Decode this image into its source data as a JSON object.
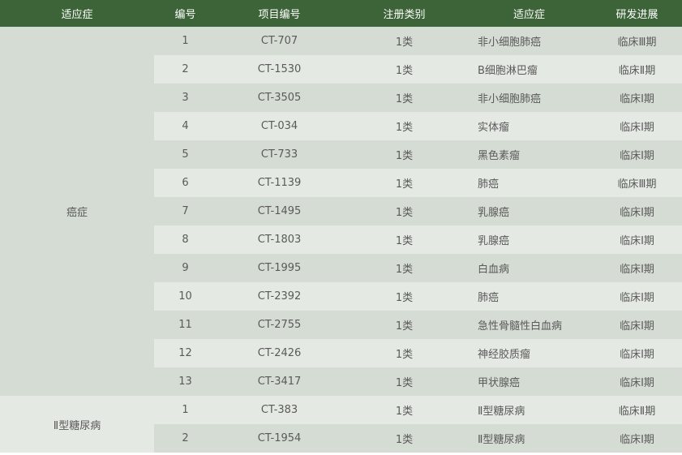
{
  "header": {
    "group": "适应症",
    "num": "编号",
    "code": "项目编号",
    "reg": "注册类别",
    "ind": "适应症",
    "stage": "研发进展"
  },
  "groups": [
    {
      "name": "癌症",
      "rows": [
        {
          "num": "1",
          "code": "CT-707",
          "reg": "1类",
          "ind": "非小细胞肺癌",
          "stage": "临床Ⅲ期"
        },
        {
          "num": "2",
          "code": "CT-1530",
          "reg": "1类",
          "ind": "B细胞淋巴瘤",
          "stage": "临床Ⅱ期"
        },
        {
          "num": "3",
          "code": "CT-3505",
          "reg": "1类",
          "ind": "非小细胞肺癌",
          "stage": "临床Ⅰ期"
        },
        {
          "num": "4",
          "code": "CT-034",
          "reg": "1类",
          "ind": "实体瘤",
          "stage": "临床Ⅰ期"
        },
        {
          "num": "5",
          "code": "CT-733",
          "reg": "1类",
          "ind": "黑色素瘤",
          "stage": "临床Ⅰ期"
        },
        {
          "num": "6",
          "code": "CT-1139",
          "reg": "1类",
          "ind": "肺癌",
          "stage": "临床Ⅲ期"
        },
        {
          "num": "7",
          "code": "CT-1495",
          "reg": "1类",
          "ind": "乳腺癌",
          "stage": "临床Ⅰ期"
        },
        {
          "num": "8",
          "code": "CT-1803",
          "reg": "1类",
          "ind": "乳腺癌",
          "stage": "临床Ⅰ期"
        },
        {
          "num": "9",
          "code": "CT-1995",
          "reg": "1类",
          "ind": "白血病",
          "stage": "临床Ⅰ期"
        },
        {
          "num": "10",
          "code": "CT-2392",
          "reg": "1类",
          "ind": "肺癌",
          "stage": "临床Ⅰ期"
        },
        {
          "num": "11",
          "code": "CT-2755",
          "reg": "1类",
          "ind": "急性骨髓性白血病",
          "stage": "临床Ⅰ期"
        },
        {
          "num": "12",
          "code": "CT-2426",
          "reg": "1类",
          "ind": "神经胶质瘤",
          "stage": "临床Ⅰ期"
        },
        {
          "num": "13",
          "code": "CT-3417",
          "reg": "1类",
          "ind": "甲状腺癌",
          "stage": "临床Ⅰ期"
        }
      ]
    },
    {
      "name": "Ⅱ型糖尿病",
      "rows": [
        {
          "num": "1",
          "code": "CT-383",
          "reg": "1类",
          "ind": "Ⅱ型糖尿病",
          "stage": "临床Ⅱ期"
        },
        {
          "num": "2",
          "code": "CT-1954",
          "reg": "1类",
          "ind": "Ⅱ型糖尿病",
          "stage": "临床Ⅰ期"
        }
      ]
    }
  ]
}
